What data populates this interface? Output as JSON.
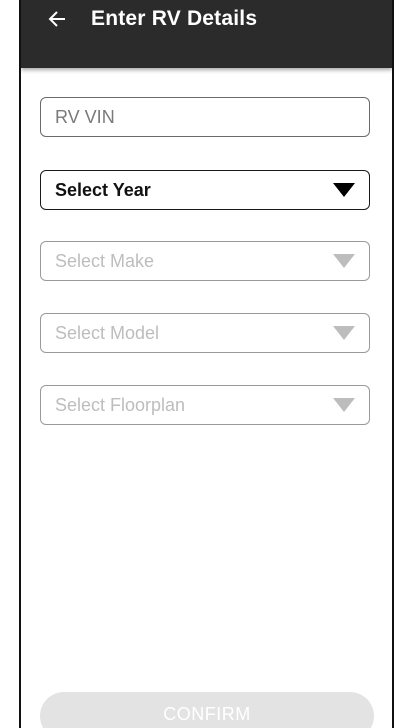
{
  "appbar": {
    "title": "Enter RV Details",
    "back_icon": "arrow-left-icon",
    "background": "#2b2b2b"
  },
  "form": {
    "vin": {
      "placeholder": "RV VIN",
      "value": ""
    },
    "year": {
      "label": "Select Year",
      "icon": "caret-down-icon"
    },
    "make": {
      "label": "Select Make",
      "icon": "caret-down-icon"
    },
    "model": {
      "label": "Select Model",
      "icon": "caret-down-icon"
    },
    "floorplan": {
      "label": "Select Floorplan",
      "icon": "caret-down-icon"
    }
  },
  "footer": {
    "confirm_label": "CONFIRM"
  },
  "colors": {
    "disabled_text": "#bdbdbd",
    "confirm_disabled_bg": "#e3e3e3"
  }
}
